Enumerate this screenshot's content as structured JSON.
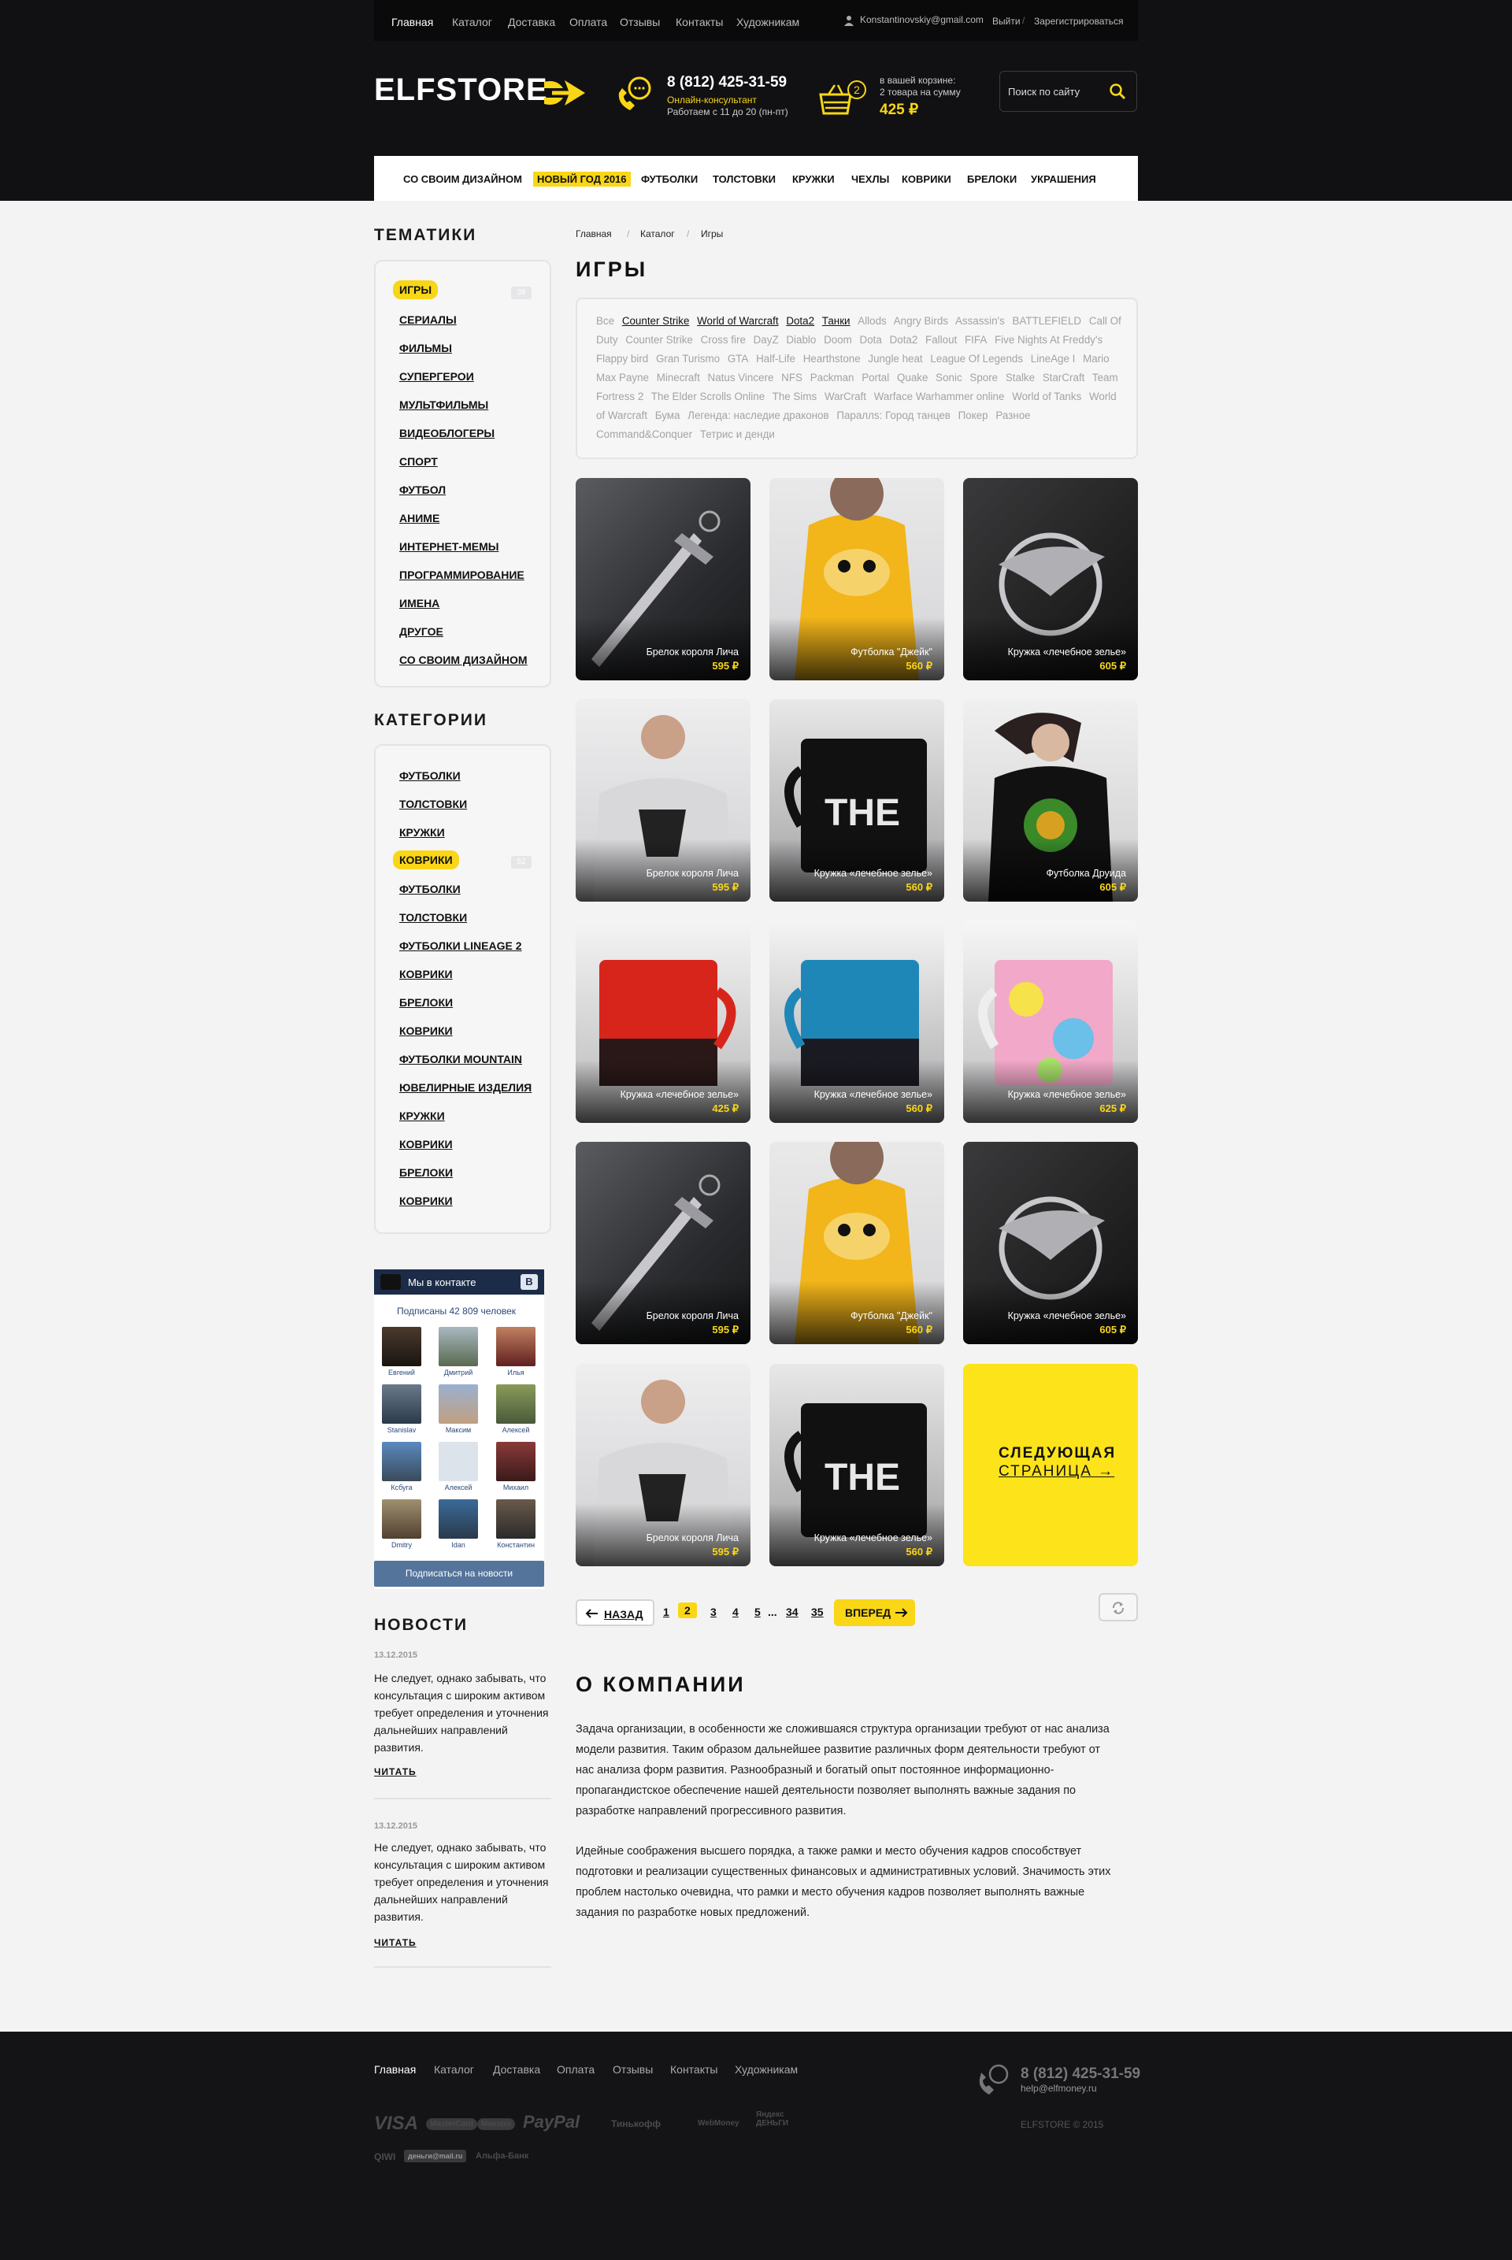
{
  "topnav": {
    "links": [
      "Главная",
      "Каталог",
      "Доставка",
      "Оплата",
      "Отзывы",
      "Контакты",
      "Художникам"
    ],
    "email": "Konstantinovskiy@gmail.com",
    "logout": "Выйти",
    "register": "Зарегистрироваться"
  },
  "header": {
    "logo": "ELFSTORE",
    "phone": "8 (812) 425-31-59",
    "consultant": "Онлайн-консультант",
    "hours": "Работаем с 11 до 20 (пн-пт)",
    "cart_count": "2",
    "cart_line1": "в вашей корзине:",
    "cart_line2": "2 товара на сумму",
    "cart_total": "425 ₽",
    "search_placeholder": "Поиск по сайту"
  },
  "catbar": [
    "СО СВОИМ ДИЗАЙНОМ",
    "НОВЫЙ ГОД 2016",
    "ФУТБОЛКИ",
    "ТОЛСТОВКИ",
    "КРУЖКИ",
    "ЧЕХЛЫ",
    "КОВРИКИ",
    "БРЕЛОКИ",
    "УКРАШЕНИЯ"
  ],
  "sidebar": {
    "themes_title": "ТЕМАТИКИ",
    "themes": [
      "ИГРЫ",
      "СЕРИАЛЫ",
      "ФИЛЬМЫ",
      "СУПЕРГЕРОИ",
      "МУЛЬТФИЛЬМЫ",
      "ВИДЕОБЛОГЕРЫ",
      "СПОРТ",
      "ФУТБОЛ",
      "АНИМЕ",
      "ИНТЕРНЕТ-МЕМЫ",
      "ПРОГРАММИРОВАНИЕ",
      "ИМЕНА",
      "ДРУГОЕ",
      "СО СВОИМ ДИЗАЙНОМ"
    ],
    "themes_count": "38",
    "categories_title": "КАТЕГОРИИ",
    "categories": [
      "ФУТБОЛКИ",
      "ТОЛСТОВКИ",
      "КРУЖКИ",
      "КОВРИКИ",
      "ФУТБОЛКИ",
      "ТОЛСТОВКИ",
      "ФУТБОЛКИ LINEAGE 2",
      "КОВРИКИ",
      "БРЕЛОКИ",
      "КОВРИКИ",
      "ФУТБОЛКИ MOUNTAIN",
      "ЮВЕЛИРНЫЕ ИЗДЕЛИЯ",
      "КРУЖКИ",
      "КОВРИКИ",
      "БРЕЛОКИ",
      "КОВРИКИ"
    ],
    "categories_count": "52"
  },
  "vk": {
    "title": "Мы в контакте",
    "badge": "В",
    "subscribers": "Подписаны 42 809 человек",
    "members": [
      "Евгений",
      "Дмитрий",
      "Илья",
      "Stanislav",
      "Максим",
      "Алексей",
      "Ксбуга",
      "Алексей",
      "Михаил",
      "Dmitry",
      "Idan",
      "Константин"
    ],
    "button": "Подписаться на новости"
  },
  "news": {
    "title": "НОВОСТИ",
    "items": [
      {
        "date": "13.12.2015",
        "text": "Не следует, однако забывать, что консультация с широким активом требует определения и уточнения дальнейших направлений развития.",
        "read": "ЧИТАТЬ"
      },
      {
        "date": "13.12.2015",
        "text": "Не следует, однако забывать, что консультация с широким активом требует определения и уточнения дальнейших направлений развития.",
        "read": "ЧИТАТЬ"
      }
    ]
  },
  "breadcrumb": [
    "Главная",
    "Каталог",
    "Игры"
  ],
  "page_title": "ИГРЫ",
  "tags": {
    "all": "Все",
    "bold": [
      "Counter Strike",
      "World of Warcraft",
      "Dota2",
      "Танки"
    ],
    "rest": [
      "Allods",
      "Angry Birds",
      "Assassin's",
      "BATTLEFIELD",
      "Call Of Duty",
      "Counter Strike",
      "Cross fire",
      "DayZ",
      "Diablo",
      "Doom",
      "Dota",
      "Dota2",
      "Fallout",
      "FIFA",
      "Five Nights At Freddy's",
      "Flappy bird",
      "Gran Turismo",
      "GTA",
      "Half-Life",
      "Hearthstone",
      "Jungle heat",
      "League Of Legends",
      "LineAge I",
      "Mario",
      "Max Payne",
      "Minecraft",
      "Natus Vincere",
      "NFS",
      "Packman",
      "Portal",
      "Quake",
      "Sonic",
      "Spore",
      "Stalke",
      "StarCraft",
      "Team Fortress 2",
      "The Elder Scrolls Online",
      "The Sims",
      "WarCraft",
      "Warface Warhammer online",
      "World of Tanks",
      "World of Warcraft",
      "Бума",
      "Легенда: наследие драконов",
      "Параллs: Город танцев",
      "Покер",
      "Разное",
      "Command&Conquer",
      "Тетрис и денди"
    ]
  },
  "products": [
    {
      "name": "Брелок короля Лича",
      "price": "595 ₽"
    },
    {
      "name": "Футболка \"Джейк\"",
      "price": "560 ₽"
    },
    {
      "name": "Кружка «лечебное зелье»",
      "price": "605 ₽"
    },
    {
      "name": "Брелок короля Лича",
      "price": "595 ₽"
    },
    {
      "name": "Кружка «лечебное зелье»",
      "price": "560 ₽"
    },
    {
      "name": "Футболка Друида",
      "price": "605 ₽"
    },
    {
      "name": "Кружка «лечебное зелье»",
      "price": "425 ₽"
    },
    {
      "name": "Кружка «лечебное зелье»",
      "price": "560 ₽"
    },
    {
      "name": "Кружка «лечебное зелье»",
      "price": "625 ₽"
    },
    {
      "name": "Брелок короля Лича",
      "price": "595 ₽"
    },
    {
      "name": "Футболка \"Джейк\"",
      "price": "560 ₽"
    },
    {
      "name": "Кружка «лечебное зелье»",
      "price": "605 ₽"
    },
    {
      "name": "Брелок короля Лича",
      "price": "595 ₽"
    },
    {
      "name": "Кружка «лечебное зелье»",
      "price": "560 ₽"
    }
  ],
  "next_page": {
    "line1": "СЛЕДУЮЩАЯ",
    "line2": "СТРАНИЦА →"
  },
  "pagination": {
    "back": "НАЗАД",
    "forward": "ВПЕРЕД",
    "pages": [
      "1",
      "2",
      "3",
      "4",
      "5",
      "...",
      "34",
      "35"
    ],
    "current": "2"
  },
  "about": {
    "title": "О КОМПАНИИ",
    "p1": "Задача организации, в особенности же сложившаяся структура организации требуют от нас анализа модели развития. Таким образом дальнейшее развитие различных форм деятельности требуют от нас анализа форм развития. Разнообразный и богатый опыт постоянное информационно-пропагандистское обеспечение нашей деятельности позволяет выполнять важные задания по разработке направлений прогрессивного развития.",
    "p2": "Идейные соображения высшего порядка, а также рамки и место обучения кадров способствует подготовки и реализации существенных финансовых и административных условий. Значимость этих проблем настолько очевидна, что рамки и место обучения кадров позволяет выполнять важные задания по разработке новых предложений."
  },
  "footer": {
    "links": [
      "Главная",
      "Каталог",
      "Доставка",
      "Оплата",
      "Отзывы",
      "Контакты",
      "Художникам"
    ],
    "phone": "8 (812) 425-31-59",
    "email": "help@elfmoney.ru",
    "copyright": "ELFSTORE © 2015",
    "payments": [
      "VISA",
      "MasterCard",
      "Maestro",
      "PayPal",
      "Тинькофф",
      "WebMoney",
      "Яндекс ДЕНЬГИ",
      "QIWI",
      "деньги@mail.ru",
      "Альфа-Банк"
    ]
  },
  "colors": {
    "accent": "#f9d616",
    "header_bg": "#111113",
    "footer_bg": "#141416",
    "page_bg": "#f3f3f4",
    "vk_blue": "#54749c"
  }
}
